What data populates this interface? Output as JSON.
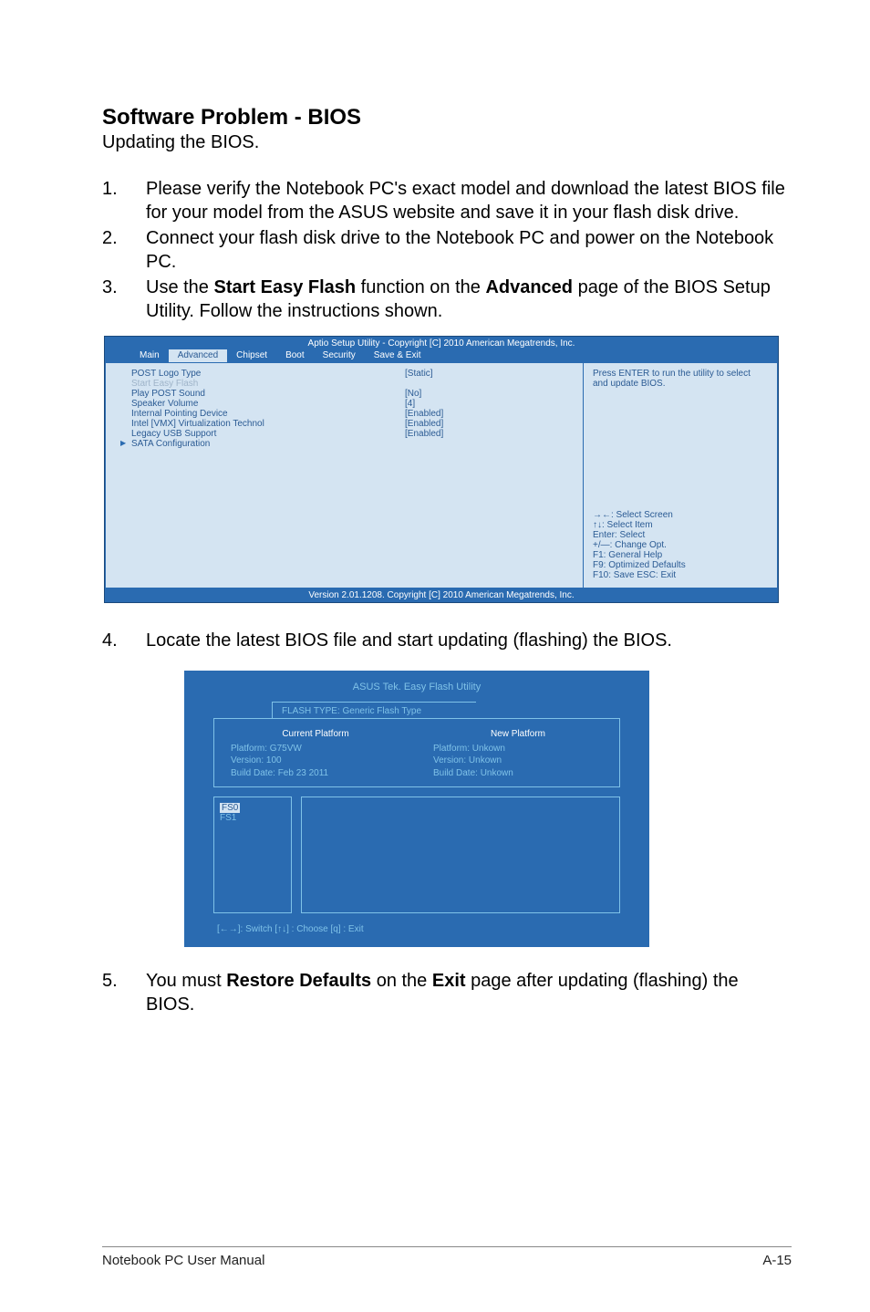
{
  "heading": "Software Problem - BIOS",
  "subheading": "Updating the BIOS.",
  "steps": {
    "s1": {
      "num": "1.",
      "text_a": "Please verify the Notebook PC's exact model and download the latest BIOS file for your model from the ASUS website and save it in your flash disk drive."
    },
    "s2": {
      "num": "2.",
      "text_a": "Connect your flash disk drive to the Notebook PC and power on the Notebook PC."
    },
    "s3": {
      "num": "3.",
      "text_a": "Use the ",
      "bold_a": "Start Easy Flash",
      "text_b": " function on the ",
      "bold_b": "Advanced",
      "text_c": " page of the BIOS Setup Utility. Follow the instructions shown."
    },
    "s4": {
      "num": "4.",
      "text_a": "Locate the latest BIOS file and start updating (flashing) the BIOS."
    },
    "s5": {
      "num": "5.",
      "text_a": "You must ",
      "bold_a": "Restore Defaults",
      "text_b": " on the ",
      "bold_b": "Exit",
      "text_c": " page after updating (flashing) the BIOS."
    }
  },
  "bios1": {
    "title": "Aptio Setup Utility - Copyright [C] 2010 American Megatrends, Inc.",
    "tabs": [
      "Main",
      "Advanced",
      "Chipset",
      "Boot",
      "Security",
      "Save & Exit"
    ],
    "active_tab_index": 1,
    "rows": [
      {
        "label": "POST Logo Type",
        "value": "[Static]"
      },
      {
        "label": "Start Easy Flash",
        "value": "",
        "dim": true
      },
      {
        "label": "Play POST Sound",
        "value": "[No]"
      },
      {
        "label": "Speaker Volume",
        "value": "[4]"
      },
      {
        "label": "Internal Pointing Device",
        "value": "[Enabled]"
      },
      {
        "label": "",
        "value": ""
      },
      {
        "label": "Intel [VMX] Virtualization Technol",
        "value": "[Enabled]"
      },
      {
        "label": "Legacy USB Support",
        "value": "[Enabled]"
      }
    ],
    "sata_label": "SATA Configuration",
    "help_top": "Press ENTER to run the utility to select and update BIOS.",
    "help_keys": [
      "→←:  Select Screen",
      "↑↓:    Select Item",
      "Enter: Select",
      "+/—:  Change Opt.",
      "F1:     General Help",
      "F9:     Optimized Defaults",
      "F10:  Save    ESC: Exit"
    ],
    "footer": "Version 2.01.1208. Copyright [C] 2010 American Megatrends, Inc."
  },
  "bios2": {
    "title": "ASUS Tek. Easy Flash Utility",
    "flash_type": "FLASH TYPE: Generic Flash Type",
    "current": {
      "hdr": "Current Platform",
      "lines": [
        "Platform:   G75VW",
        "Version:     100",
        "Build Date: Feb 23 2011"
      ]
    },
    "new": {
      "hdr": "New Platform",
      "lines": [
        "Platform:   Unkown",
        "Version:     Unkown",
        "Build Date: Unkown"
      ]
    },
    "file_items": [
      "FS0",
      "FS1"
    ],
    "help": "[←→]: Switch   [↑↓] : Choose   [q] : Exit"
  },
  "footer": {
    "left": "Notebook PC User Manual",
    "right": "A-15"
  }
}
